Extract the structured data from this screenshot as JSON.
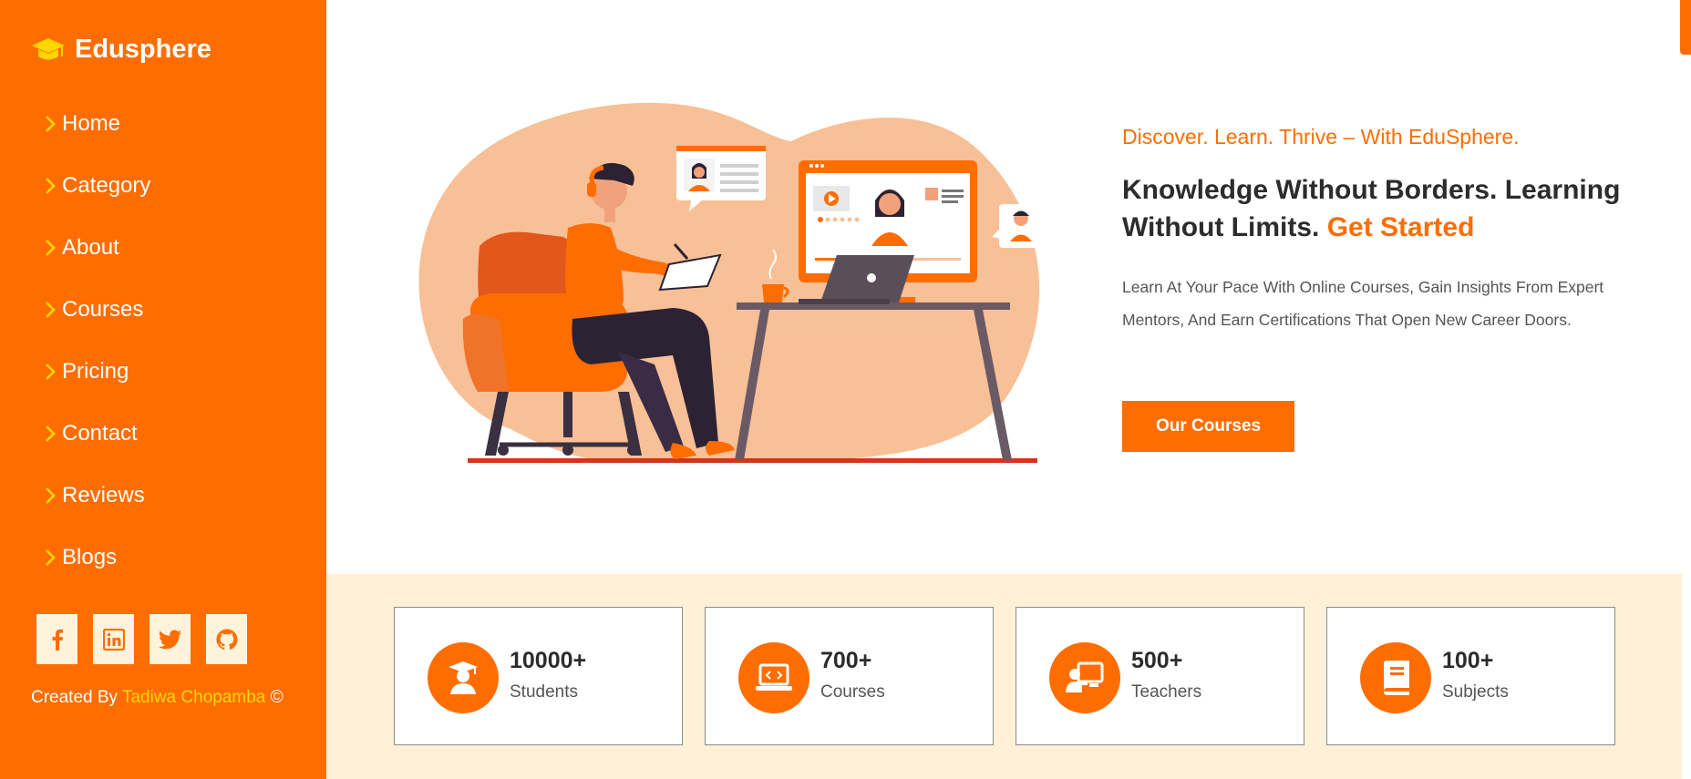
{
  "brand": {
    "name": "Edusphere",
    "icon": "graduation-cap-icon"
  },
  "sidebar": {
    "items": [
      {
        "label": "Home"
      },
      {
        "label": "Category"
      },
      {
        "label": "About"
      },
      {
        "label": "Courses"
      },
      {
        "label": "Pricing"
      },
      {
        "label": "Contact"
      },
      {
        "label": "Reviews"
      },
      {
        "label": "Blogs"
      }
    ],
    "socials": [
      "facebook-icon",
      "linkedin-icon",
      "twitter-icon",
      "github-icon"
    ],
    "credit": {
      "prefix": "Created By ",
      "author": "Tadiwa Chopamba",
      "suffix": " ©"
    }
  },
  "hero": {
    "tagline": "Discover. Learn. Thrive – With EduSphere.",
    "headline": "Knowledge Without Borders. Learning Without Limits.",
    "headline_accent": "Get Started",
    "description": "Learn At Your Pace With Online Courses, Gain Insights From Expert Mentors, And Earn Certifications That Open New Career Doors.",
    "cta_label": "Our Courses"
  },
  "stats": [
    {
      "value": "10000+",
      "label": "Students",
      "icon": "student-icon"
    },
    {
      "value": "700+",
      "label": "Courses",
      "icon": "laptop-code-icon"
    },
    {
      "value": "500+",
      "label": "Teachers",
      "icon": "teacher-icon"
    },
    {
      "value": "100+",
      "label": "Subjects",
      "icon": "book-icon"
    }
  ],
  "colors": {
    "accent": "#ff6d00",
    "credit_highlight": "#ffd600",
    "stats_band": "#fef1d8"
  }
}
